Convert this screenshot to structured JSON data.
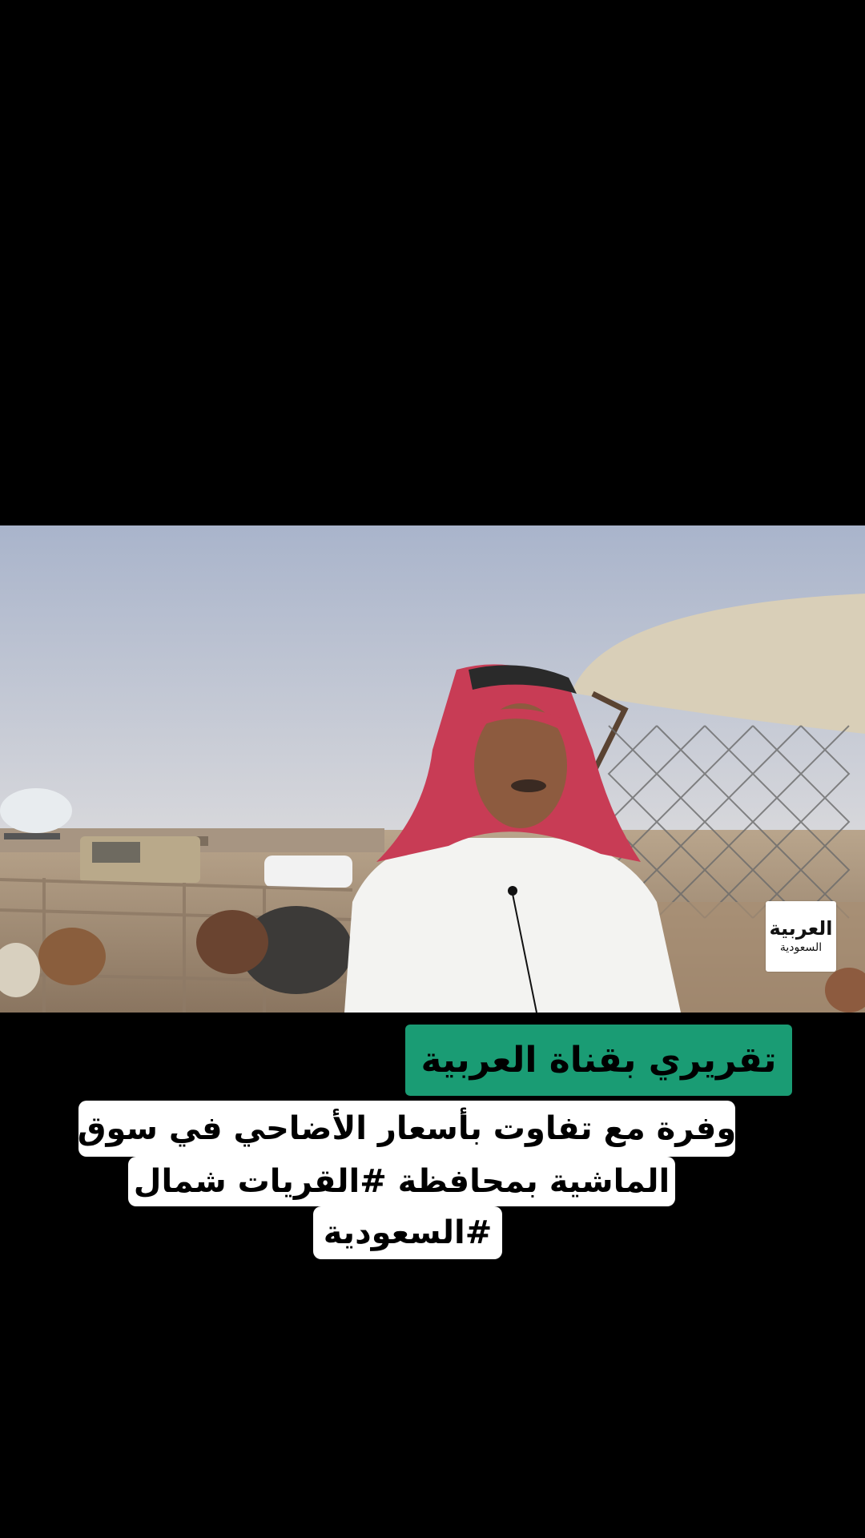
{
  "video": {
    "channel_logo": {
      "name": "العربية",
      "subtitle": "السعودية"
    }
  },
  "overlay": {
    "tag": "تقريري بقناة العربية",
    "caption_lines": [
      "وفرة مع تفاوت بأسعار الأضاحي في سوق",
      "الماشية بمحافظة  #القريات  شمال",
      "#السعودية"
    ]
  },
  "colors": {
    "background": "#000000",
    "tag_badge": "#1a9c74",
    "caption_box": "#ffffff"
  }
}
